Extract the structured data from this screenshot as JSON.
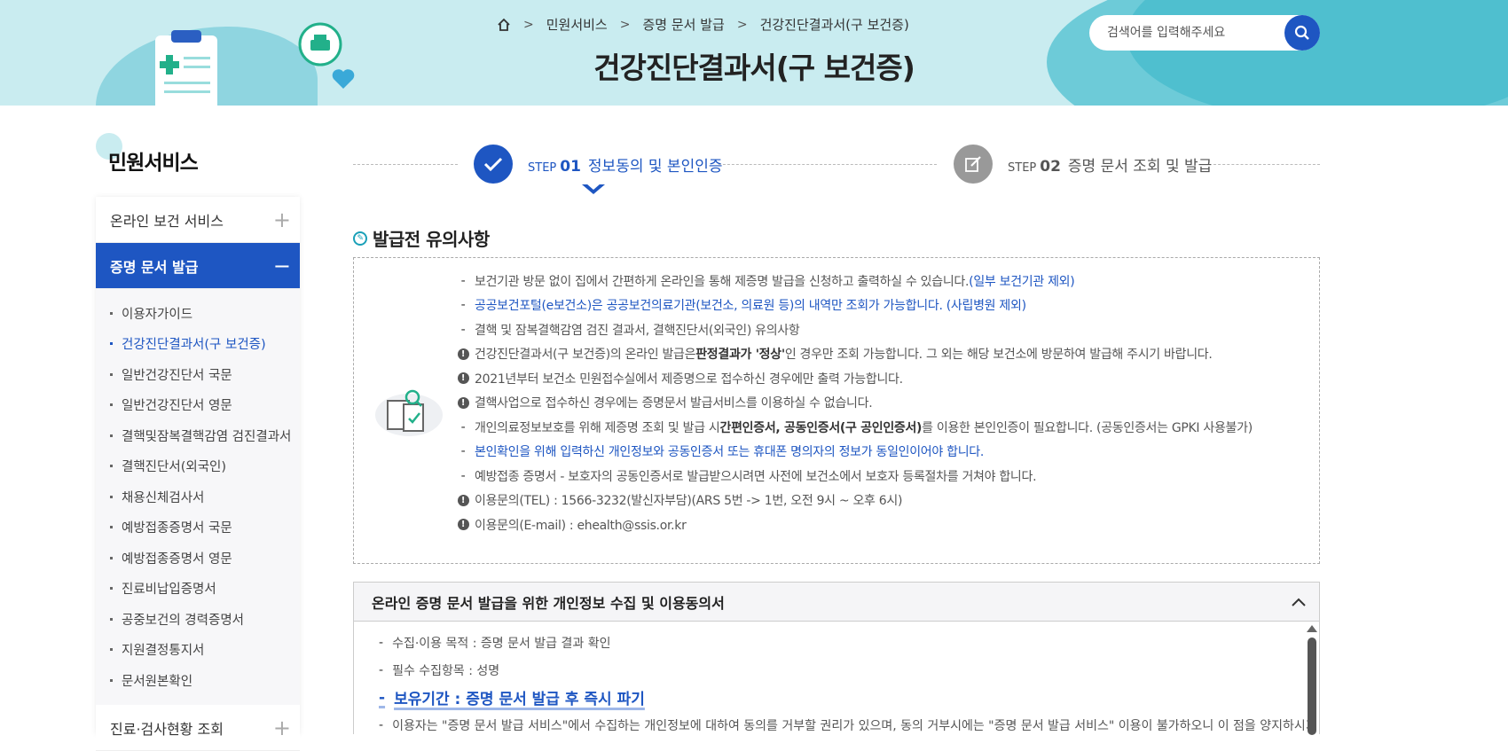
{
  "header": {
    "breadcrumb": [
      "민원서비스",
      "증명 문서 발급",
      "건강진단결과서(구 보건증)"
    ],
    "title": "건강진단결과서(구 보건증)",
    "search_placeholder": "검색어를 입력해주세요"
  },
  "sidebar": {
    "title": "민원서비스",
    "menus": [
      {
        "label": "온라인 보건 서비스",
        "toggle": "+"
      },
      {
        "label": "증명 문서 발급",
        "toggle": "−"
      }
    ],
    "sub_items": [
      "이용자가이드",
      "건강진단결과서(구 보건증)",
      "일반건강진단서 국문",
      "일반건강진단서 영문",
      "결핵및잠복결핵감염 검진결과서",
      "결핵진단서(외국인)",
      "채용신체검사서",
      "예방접종증명서 국문",
      "예방접종증명서 영문",
      "진료비납입증명서",
      "공중보건의 경력증명서",
      "지원결정통지서",
      "문서원본확인"
    ],
    "last_menu": {
      "label": "진료·검사현황 조회",
      "toggle": "+"
    }
  },
  "steps": [
    {
      "prefix": "STEP",
      "num": "01",
      "label": "정보동의 및 본인인증",
      "state": "active"
    },
    {
      "prefix": "STEP",
      "num": "02",
      "label": "증명 문서 조회 및 발급",
      "state": "inactive"
    }
  ],
  "notice": {
    "title": "발급전 유의사항",
    "lines": {
      "l1a": "보건기관 방문 없이 집에서 간편하게 온라인을 통해 제증명 발급을 신청하고 출력하실 수 있습니다.",
      "l1b": "(일부 보건기관 제외)",
      "l2": "공공보건포털(e보건소)은 공공보건의료기관(보건소, 의료원 등)의 내역만 조회가 가능합니다. (사립병원 제외)",
      "l3": "결핵 및 잠복결핵감염 검진 결과서, 결핵진단서(외국인) 유의사항",
      "l4a": "건강진단결과서(구 보건증)의 온라인 발급은 ",
      "l4b": "판정결과가 '정상'",
      "l4c": "인 경우만 조회 가능합니다. 그 외는 해당 보건소에 방문하여 발급해 주시기 바랍니다.",
      "l5": "2021년부터 보건소 민원접수실에서 제증명으로 접수하신 경우에만 출력 가능합니다.",
      "l6": "결핵사업으로 접수하신 경우에는 증명문서 발급서비스를 이용하실 수 없습니다.",
      "l7a": "개인의료정보보호를 위해 제증명 조회 및 발급 시 ",
      "l7b": "간편인증서, 공동인증서(구 공인인증서)",
      "l7c": "를 이용한 본인인증이 필요합니다. (공동인증서는 GPKI 사용불가)",
      "l8": "본인확인을 위해 입력하신 개인정보와 공동인증서 또는 휴대폰 명의자의 정보가 동일인이어야 합니다.",
      "l9": "예방접종 증명서 - 보호자의 공동인증서로 발급받으시려면 사전에 보건소에서 보호자 등록절차를 거쳐야 합니다.",
      "l10": "이용문의(TEL) : 1566-3232(발신자부담)(ARS 5번 -> 1번, 오전 9시 ~ 오후 6시)",
      "l11": "이용문의(E-mail) : ehealth@ssis.or.kr"
    }
  },
  "agreement": {
    "title": "온라인 증명 문서 발급을 위한 개인정보 수집 및 이용동의서",
    "lines": [
      "수집·이용 목적 : 증명 문서 발급 결과 확인",
      "필수 수집항목 : 성명",
      "보유기간 : 증명 문서 발급 후 즉시 파기",
      "이용자는 \"증명 문서 발급 서비스\"에서 수집하는 개인정보에 대하여 동의를 거부할 권리가 있으며, 동의 거부시에는 \"증명 문서 발급 서비스\" 이용이 불가하오니 이 점을 양지하시기"
    ]
  },
  "colors": {
    "accent": "#1e56c2",
    "banner": "#c9ecf0",
    "teal": "#1aa0b8"
  }
}
